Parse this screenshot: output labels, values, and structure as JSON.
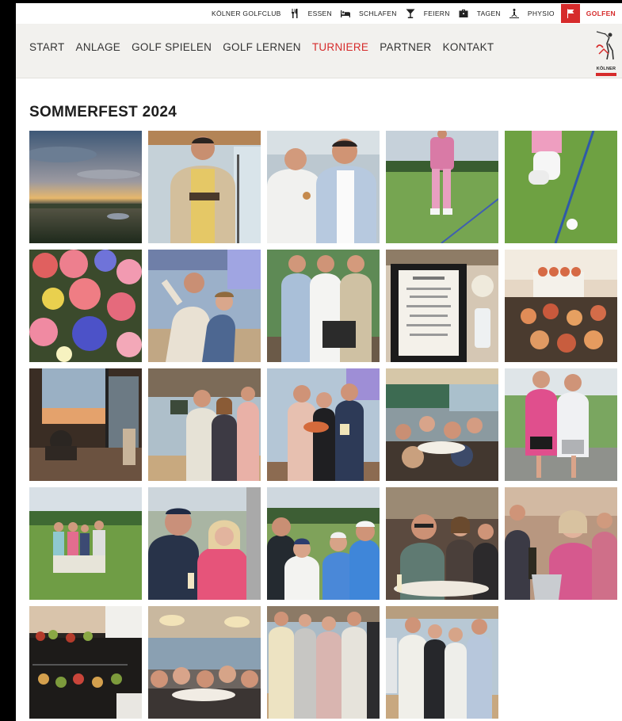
{
  "topbar": {
    "items": [
      {
        "label": "KÖLNER GOLFCLUB",
        "icon": null
      },
      {
        "label": "ESSEN",
        "icon": "cutlery-icon"
      },
      {
        "label": "SCHLAFEN",
        "icon": "bed-icon"
      },
      {
        "label": "FEIERN",
        "icon": "cocktail-icon"
      },
      {
        "label": "TAGEN",
        "icon": "briefcase-icon"
      },
      {
        "label": "PHYSIO",
        "icon": "physio-icon"
      },
      {
        "label": "GOLFEN",
        "icon": "flag-icon",
        "active": true
      }
    ]
  },
  "nav": {
    "items": [
      "START",
      "ANLAGE",
      "GOLF SPIELEN",
      "GOLF LERNEN",
      "TURNIERE",
      "PARTNER",
      "KONTAKT"
    ],
    "active": "TURNIERE"
  },
  "logo": {
    "text": "KÖLNER"
  },
  "page": {
    "title": "SOMMERFEST 2024"
  },
  "gallery": {
    "photos": [
      {
        "name": "sunset-over-course-photo"
      },
      {
        "name": "man-with-award-photo"
      },
      {
        "name": "two-men-toasting-photo"
      },
      {
        "name": "golfer-pink-outfit-photo"
      },
      {
        "name": "golf-shoe-ball-photo"
      },
      {
        "name": "flower-bouquet-photo"
      },
      {
        "name": "dancing-couple-photo"
      },
      {
        "name": "group-three-men-photo"
      },
      {
        "name": "menu-card-photo"
      },
      {
        "name": "dessert-table-photo"
      },
      {
        "name": "clubhouse-terrace-photo"
      },
      {
        "name": "people-greeting-photo"
      },
      {
        "name": "prize-ceremony-photo"
      },
      {
        "name": "dining-hall-photo"
      },
      {
        "name": "two-women-course-photo"
      },
      {
        "name": "group-on-fairway-photo"
      },
      {
        "name": "couple-with-drinks-photo"
      },
      {
        "name": "group-toast-photo"
      },
      {
        "name": "dinner-table-photo"
      },
      {
        "name": "women-champagne-photo"
      },
      {
        "name": "food-platter-photo"
      },
      {
        "name": "restaurant-guests-photo"
      },
      {
        "name": "winners-lineup-photo"
      },
      {
        "name": "award-group-photo"
      }
    ]
  }
}
